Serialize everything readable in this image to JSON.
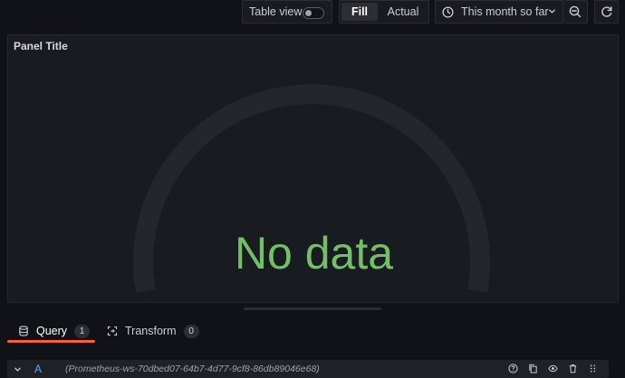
{
  "toolbar": {
    "table_view_label": "Table view",
    "table_view_on": false,
    "fill_label": "Fill",
    "actual_label": "Actual",
    "time_range": "This month so far"
  },
  "panel": {
    "title": "Panel Title",
    "no_data_text": "No data",
    "gauge_color": "#73bf69"
  },
  "tabs": [
    {
      "label": "Query",
      "count": "1",
      "active": true
    },
    {
      "label": "Transform",
      "count": "0",
      "active": false
    }
  ],
  "query": {
    "ref_id": "A",
    "datasource": "(Prometheus-ws-70dbed07-64b7-4d77-9cf8-86db89046e68)"
  },
  "colors": {
    "accent": "#f55f3e",
    "background": "#111217",
    "panel_bg": "#181b1f"
  }
}
